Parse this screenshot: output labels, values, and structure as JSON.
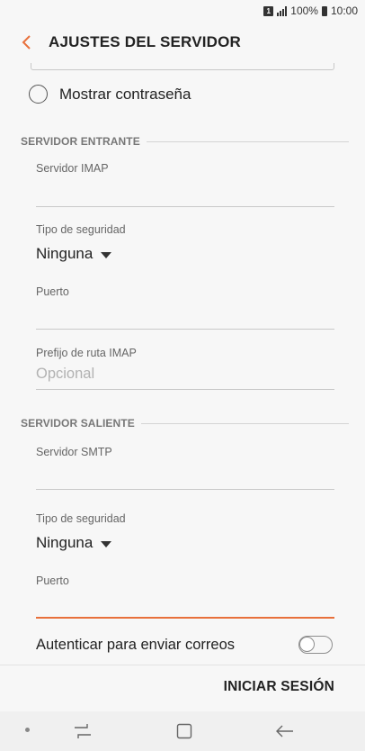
{
  "status_bar": {
    "sim": "1",
    "battery": "100%",
    "time": "10:00"
  },
  "header": {
    "title": "AJUSTES DEL SERVIDOR"
  },
  "show_password": {
    "label": "Mostrar contraseña"
  },
  "incoming": {
    "section": "SERVIDOR ENTRANTE",
    "server_label": "Servidor IMAP",
    "security_label": "Tipo de seguridad",
    "security_value": "Ninguna",
    "port_label": "Puerto",
    "prefix_label": "Prefijo de ruta IMAP",
    "prefix_placeholder": "Opcional"
  },
  "outgoing": {
    "section": "SERVIDOR SALIENTE",
    "server_label": "Servidor SMTP",
    "security_label": "Tipo de seguridad",
    "security_value": "Ninguna",
    "port_label": "Puerto",
    "auth_label": "Autenticar para enviar correos",
    "auth_enabled": false
  },
  "footer": {
    "login_label": "INICIAR SESIÓN"
  },
  "colors": {
    "accent": "#e8703b",
    "background": "#f7f7f7"
  }
}
